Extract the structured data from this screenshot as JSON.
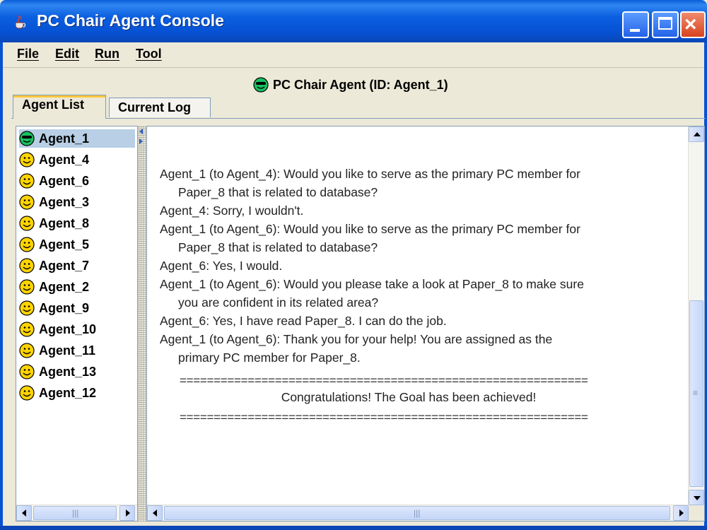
{
  "window": {
    "title": "PC Chair Agent Console",
    "controls": [
      "minimize",
      "maximize",
      "close"
    ],
    "close_glyph": "×"
  },
  "menu": [
    "File",
    "Edit",
    "Run",
    "Tool"
  ],
  "header": {
    "title": "PC Chair Agent (ID: Agent_1)",
    "icon": "sunglasses-smiley-icon"
  },
  "tabs": [
    {
      "label": "Agent List",
      "active": true
    },
    {
      "label": "Current Log",
      "active": false
    }
  ],
  "agents": [
    {
      "name": "Agent_1",
      "selected": true,
      "icon": "sunglasses-smiley-icon"
    },
    {
      "name": "Agent_4",
      "icon": "smiley-icon"
    },
    {
      "name": "Agent_6",
      "icon": "smiley-icon"
    },
    {
      "name": "Agent_3",
      "icon": "smiley-icon"
    },
    {
      "name": "Agent_8",
      "icon": "smiley-icon"
    },
    {
      "name": "Agent_5",
      "icon": "smiley-icon"
    },
    {
      "name": "Agent_7",
      "icon": "smiley-icon"
    },
    {
      "name": "Agent_2",
      "icon": "smiley-icon"
    },
    {
      "name": "Agent_9",
      "icon": "smiley-icon"
    },
    {
      "name": "Agent_10",
      "icon": "smiley-icon"
    },
    {
      "name": "Agent_11",
      "icon": "smiley-icon"
    },
    {
      "name": "Agent_13",
      "icon": "smiley-icon"
    },
    {
      "name": "Agent_12",
      "icon": "smiley-icon"
    }
  ],
  "log": {
    "lines": [
      "Agent_1 (to Agent_4): Would you like to serve as the primary PC member for",
      "Paper_8 that is related to database?",
      "Agent_4: Sorry, I wouldn't.",
      "Agent_1 (to Agent_6): Would you like to serve as the primary PC member for",
      "Paper_8 that is related to database?",
      "Agent_6: Yes, I would.",
      "Agent_1 (to Agent_6): Would you please take a look at Paper_8 to make sure",
      "you are confident in its related area?",
      "Agent_6: Yes, I have read Paper_8. I can do the job.",
      "Agent_1 (to Agent_6): Thank you for your help! You are assigned as the",
      "primary PC member for Paper_8."
    ],
    "separator": "============================================================",
    "congrats": "Congratulations! The Goal has been achieved!"
  },
  "colors": {
    "titlebar": "#0752d4",
    "window_bg": "#ece9d8",
    "selection": "#b8cfe5",
    "smiley": "#ffd400"
  }
}
